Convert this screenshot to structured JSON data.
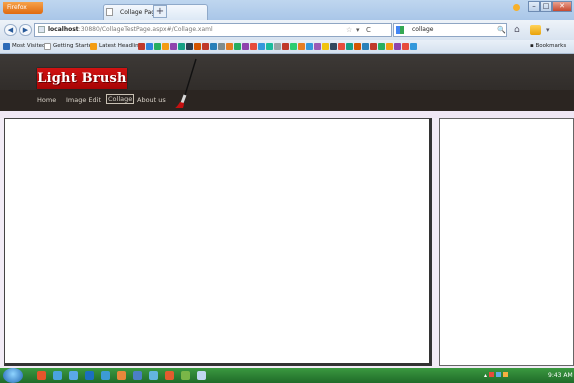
{
  "window": {
    "app_button": "Firefox",
    "tab_title": "Collage Page",
    "new_tab": "+",
    "controls": {
      "minimize": "–",
      "maximize": "□",
      "close": "✕"
    }
  },
  "navbar": {
    "back": "◀",
    "forward": "▶",
    "url_host": "localhost",
    "url_path": ":30880/CollageTestPage.aspx#/Collage.xaml",
    "url_star": "☆",
    "url_arrow": "▾",
    "url_reload": "C",
    "search_value": "collage",
    "search_go": "🔍",
    "home": "⌂",
    "menu": "▾"
  },
  "bookmarks": {
    "most_visited": "Most Visited",
    "getting_started": "Getting Started",
    "latest_headlines": "Latest Headlines",
    "right": "Bookmarks",
    "favicon_colors": [
      "#c0392b",
      "#2e86de",
      "#27ae60",
      "#f39c12",
      "#8e44ad",
      "#16a085",
      "#2c3e50",
      "#d35400",
      "#c0392b",
      "#2980b9",
      "#7f8c8d",
      "#e67e22",
      "#27ae60",
      "#8e44ad",
      "#e74c3c",
      "#3498db",
      "#1abc9c",
      "#95a5a6",
      "#c0392b",
      "#2ecc71",
      "#e67e22",
      "#3498db",
      "#9b59b6",
      "#f1c40f",
      "#34495e",
      "#e74c3c",
      "#16a085",
      "#d35400",
      "#2980b9",
      "#c0392b",
      "#27ae60",
      "#f39c12",
      "#8e44ad",
      "#e74c3c",
      "#3498db"
    ]
  },
  "header": {
    "logo": "Light Brush",
    "menu": {
      "home": "Home",
      "image_edit": "Image Edit",
      "collage": "Collage",
      "about": "About us"
    }
  },
  "colors": {
    "logo_red": "#c30b0b",
    "header_dark": "#2b2521",
    "page_bg": "#f2ecf6",
    "taskbar": "#2a7d31"
  },
  "taskbar": {
    "icons": [
      "#e6552b",
      "#4aa3df",
      "#5aa8e8",
      "#1b6fc2",
      "#3c9bd6",
      "#e8873b",
      "#4b7fc6",
      "#63b5e0",
      "#e35c2e",
      "#7ab648",
      "#bfd7f0"
    ],
    "clock": "9:43 AM"
  }
}
